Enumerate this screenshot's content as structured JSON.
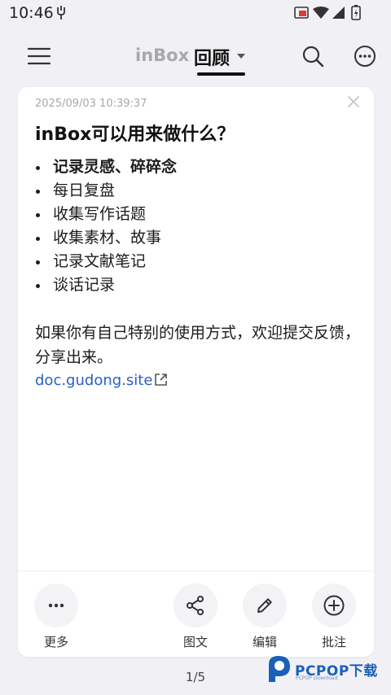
{
  "status_bar": {
    "time": "10:46",
    "icons": [
      "usb-debug-icon",
      "cast-icon",
      "wifi-icon",
      "signal-icon",
      "battery-charging-icon"
    ]
  },
  "top_bar": {
    "menu_icon": "menu-icon",
    "tabs": [
      {
        "label": "inBox",
        "active": false
      },
      {
        "label": "回顾",
        "active": true
      }
    ],
    "search_icon": "search-icon",
    "more_icon": "more-horizontal-icon"
  },
  "card": {
    "date": "2025/09/03 10:39:37",
    "title": "inBox可以用来做什么？",
    "bullets": [
      {
        "text": "记录灵感、碎碎念",
        "bold": true
      },
      {
        "text": "每日复盘",
        "bold": false
      },
      {
        "text": "收集写作话题",
        "bold": false
      },
      {
        "text": "收集素材、故事",
        "bold": false
      },
      {
        "text": "记录文献笔记",
        "bold": false
      },
      {
        "text": "谈话记录",
        "bold": false
      }
    ],
    "paragraph": "如果你有自己特别的使用方式，欢迎提交反馈，分享出来。",
    "link": "doc.gudong.site",
    "actions": [
      {
        "label": "更多",
        "icon": "more-horizontal-icon"
      },
      {
        "label": "图文",
        "icon": "share-icon"
      },
      {
        "label": "编辑",
        "icon": "pencil-icon"
      },
      {
        "label": "批注",
        "icon": "plus-circle-icon"
      }
    ]
  },
  "pager": "1/5",
  "watermark": {
    "text": "PCPOP下载",
    "sub": "PCPOP Download"
  },
  "colors": {
    "background": "#f1f1f5",
    "card": "#ffffff",
    "link": "#2a5fc4",
    "muted": "#a8a8a8"
  }
}
